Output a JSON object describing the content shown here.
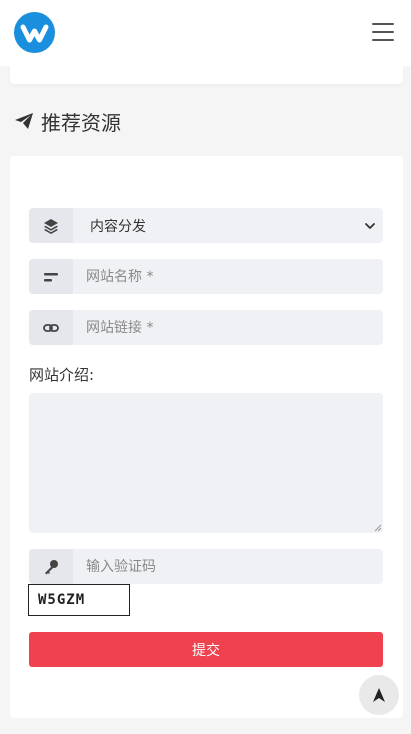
{
  "header": {
    "logo_icon": "site-logo-icon",
    "menu_icon": "hamburger-menu-icon",
    "brand_color": "#1a8fdd"
  },
  "section": {
    "icon": "paper-plane-icon",
    "title": "推荐资源"
  },
  "form": {
    "category": {
      "icon": "layers-icon",
      "selected": "内容分发"
    },
    "site_name": {
      "icon": "text-lines-icon",
      "placeholder": "网站名称 *"
    },
    "site_link": {
      "icon": "link-icon",
      "placeholder": "网站链接 *"
    },
    "intro_label": "网站介绍:",
    "verify": {
      "icon": "key-icon",
      "placeholder": "输入验证码"
    },
    "captcha_text": "W5GZM",
    "submit_label": "提交",
    "submit_color": "#f0414f"
  },
  "back_to_top": {
    "icon": "arrow-up-icon"
  }
}
